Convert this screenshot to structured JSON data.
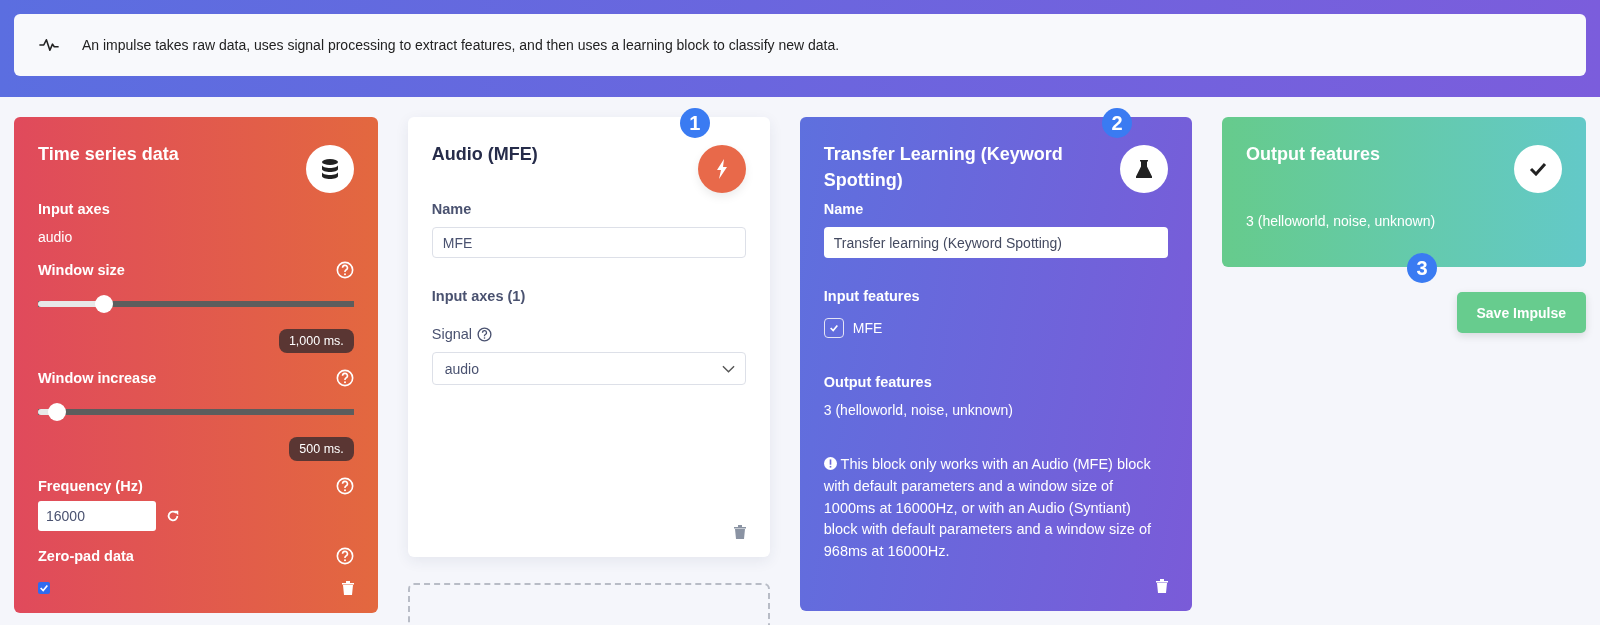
{
  "info_banner": {
    "text": "An impulse takes raw data, uses signal processing to extract features, and then uses a learning block to classify new data."
  },
  "time_series_block": {
    "title": "Time series data",
    "input_axes_label": "Input axes",
    "input_axes_value": "audio",
    "sliders": [
      {
        "label": "Window size",
        "level": 0.21,
        "reading": "1,000 ms."
      },
      {
        "label": "Window increase",
        "level": 0.06,
        "reading": "500 ms."
      }
    ],
    "frequency": {
      "label": "Frequency (Hz)",
      "value": "16000"
    },
    "zero_pad": {
      "label": "Zero-pad data",
      "checked": true
    }
  },
  "processing_block": {
    "step": "1",
    "title": "Audio (MFE)",
    "name_label": "Name",
    "name_value": "MFE",
    "input_axes_label": "Input axes (1)",
    "signal_label": "Signal",
    "signal_value": "audio"
  },
  "learning_block": {
    "step": "2",
    "title": "Transfer Learning (Keyword Spotting)",
    "name_label": "Name",
    "name_value": "Transfer learning (Keyword Spotting)",
    "input_features_label": "Input features",
    "input_features": [
      {
        "label": "MFE",
        "checked": true
      }
    ],
    "output_features_label": "Output features",
    "output_features_value": "3 (helloworld, noise, unknown)",
    "warning": "This block only works with an Audio (MFE) block with default parameters and a window size of 1000ms at 16000Hz, or with an Audio (Syntiant) block with default parameters and a window size of 968ms at 16000Hz."
  },
  "output_block": {
    "step": "3",
    "title": "Output features",
    "value": "3 (helloworld, noise, unknown)"
  },
  "save_button": {
    "label": "Save Impulse"
  }
}
